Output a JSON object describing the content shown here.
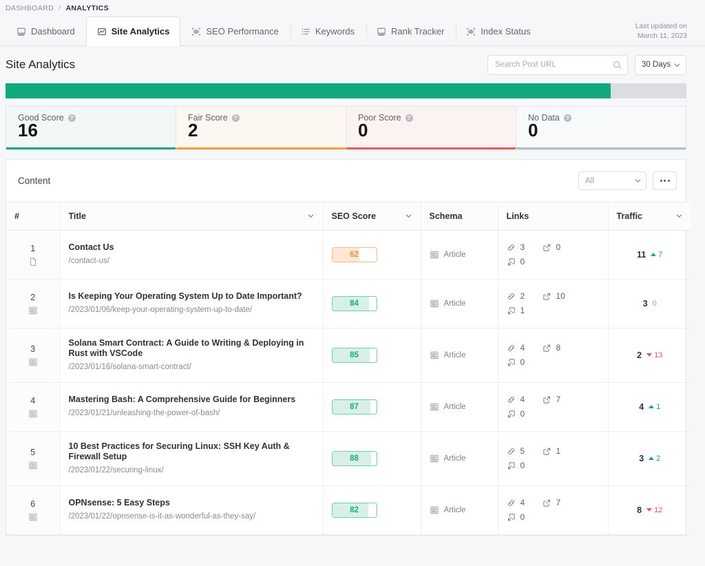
{
  "breadcrumb": {
    "root": "DASHBOARD",
    "separator": "/",
    "current": "ANALYTICS"
  },
  "tabs": [
    {
      "label": "Dashboard",
      "icon": "monitor-icon",
      "active": false
    },
    {
      "label": "Site Analytics",
      "icon": "chart-line-icon",
      "active": true
    },
    {
      "label": "SEO Performance",
      "icon": "eye-scan-icon",
      "active": false
    },
    {
      "label": "Keywords",
      "icon": "list-icon",
      "active": false
    },
    {
      "label": "Rank Tracker",
      "icon": "monitor-icon",
      "active": false
    },
    {
      "label": "Index Status",
      "icon": "eye-scan-icon",
      "active": false
    }
  ],
  "last_updated": {
    "label": "Last updated on",
    "date": "March 11, 2023"
  },
  "page": {
    "title": "Site Analytics"
  },
  "search": {
    "placeholder": "Search Post URL",
    "value": "",
    "icon": "search-icon"
  },
  "range_select": {
    "value": "30 Days",
    "icon": "chevron-down-icon"
  },
  "overall_bar": {
    "fill_percent": 88.9,
    "fill_color": "#12a97f",
    "track_color": "#dadee1"
  },
  "score_cards": [
    {
      "label": "Good Score",
      "value": "16",
      "bar_color": "#12a97f",
      "bg": "#f2f8f6",
      "help": "?"
    },
    {
      "label": "Fair Score",
      "value": "2",
      "bar_color": "#f4a03c",
      "bg": "#fcf7f1",
      "help": "?"
    },
    {
      "label": "Poor Score",
      "value": "0",
      "bar_color": "#ed5a60",
      "bg": "#fcf2f2",
      "help": "?"
    },
    {
      "label": "No Data",
      "value": "0",
      "bar_color": "#b4bcc4",
      "bg": "#f8f9fa",
      "help": "?"
    }
  ],
  "content_panel": {
    "title": "Content",
    "filter_select": {
      "value": "All",
      "icon": "chevron-down-icon"
    },
    "more_button": {
      "icon": "ellipsis-icon",
      "label": ""
    }
  },
  "table": {
    "columns": [
      {
        "key": "num",
        "label": "#",
        "sortable": false
      },
      {
        "key": "title",
        "label": "Title",
        "sortable": true
      },
      {
        "key": "seo",
        "label": "SEO Score",
        "sortable": true
      },
      {
        "key": "schema",
        "label": "Schema",
        "sortable": false
      },
      {
        "key": "links",
        "label": "Links",
        "sortable": false
      },
      {
        "key": "traffic",
        "label": "Traffic",
        "sortable": true
      }
    ],
    "rows": [
      {
        "num": "1",
        "type_icon": "page-icon",
        "title": "Contact Us",
        "url": "/contact-us/",
        "seo": {
          "value": "62",
          "color": "#ef8f3c",
          "fill": "#fce8d5",
          "border": "#f3ba85",
          "percent": 62
        },
        "schema": "Article",
        "links": {
          "internal": "3",
          "external": "0",
          "inbound": "0"
        },
        "traffic": {
          "value": "11",
          "delta": "7",
          "dir": "up"
        }
      },
      {
        "num": "2",
        "type_icon": "article-icon",
        "title": "Is Keeping Your Operating System Up to Date Important?",
        "url": "/2023/01/06/keep-your-operating-system-up-to-date/",
        "seo": {
          "value": "84",
          "color": "#1ba97e",
          "fill": "#d9f0e7",
          "border": "#6ecfb0",
          "percent": 84
        },
        "schema": "Article",
        "links": {
          "internal": "2",
          "external": "10",
          "inbound": "1"
        },
        "traffic": {
          "value": "3",
          "delta": "0",
          "dir": "zero"
        }
      },
      {
        "num": "3",
        "type_icon": "article-icon",
        "title": "Solana Smart Contract: A Guide to Writing & Deploying in Rust with VSCode",
        "url": "/2023/01/16/solana-smart-contract/",
        "seo": {
          "value": "85",
          "color": "#1ba97e",
          "fill": "#d9f0e7",
          "border": "#6ecfb0",
          "percent": 85
        },
        "schema": "Article",
        "links": {
          "internal": "4",
          "external": "8",
          "inbound": "0"
        },
        "traffic": {
          "value": "2",
          "delta": "13",
          "dir": "down"
        }
      },
      {
        "num": "4",
        "type_icon": "article-icon",
        "title": "Mastering Bash: A Comprehensive Guide for Beginners",
        "url": "/2023/01/21/unleashing-the-power-of-bash/",
        "seo": {
          "value": "87",
          "color": "#1ba97e",
          "fill": "#d9f0e7",
          "border": "#6ecfb0",
          "percent": 87
        },
        "schema": "Article",
        "links": {
          "internal": "4",
          "external": "7",
          "inbound": "0"
        },
        "traffic": {
          "value": "4",
          "delta": "1",
          "dir": "up"
        }
      },
      {
        "num": "5",
        "type_icon": "article-icon",
        "title": "10 Best Practices for Securing Linux: SSH Key Auth & Firewall Setup",
        "url": "/2023/01/22/securing-linux/",
        "seo": {
          "value": "88",
          "color": "#1ba97e",
          "fill": "#d9f0e7",
          "border": "#6ecfb0",
          "percent": 88
        },
        "schema": "Article",
        "links": {
          "internal": "5",
          "external": "1",
          "inbound": "0"
        },
        "traffic": {
          "value": "3",
          "delta": "2",
          "dir": "up"
        }
      },
      {
        "num": "6",
        "type_icon": "article-icon",
        "title": "OPNsense: 5 Easy Steps",
        "url": "/2023/01/22/opnsense-is-it-as-wonderful-as-they-say/",
        "seo": {
          "value": "82",
          "color": "#1ba97e",
          "fill": "#d9f0e7",
          "border": "#6ecfb0",
          "percent": 82
        },
        "schema": "Article",
        "links": {
          "internal": "4",
          "external": "7",
          "inbound": "0"
        },
        "traffic": {
          "value": "8",
          "delta": "12",
          "dir": "down"
        }
      }
    ]
  }
}
